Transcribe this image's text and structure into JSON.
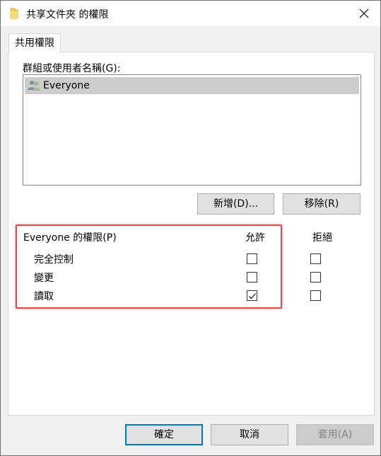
{
  "window": {
    "title": "共享文件夾 的權限",
    "close_label": "×"
  },
  "tabs": [
    {
      "label": "共用權限",
      "selected": true
    }
  ],
  "groups": {
    "label": "群組或使用者名稱(G):",
    "items": [
      {
        "name": "Everyone",
        "icon": "users-icon",
        "selected": true
      }
    ]
  },
  "group_buttons": {
    "add": "新增(D)...",
    "remove": "移除(R)"
  },
  "permissions": {
    "title": "Everyone 的權限(P)",
    "allow_header": "允許",
    "deny_header": "拒絕",
    "rows": [
      {
        "label": "完全控制",
        "allow": false,
        "deny": false
      },
      {
        "label": "變更",
        "allow": false,
        "deny": false
      },
      {
        "label": "讀取",
        "allow": true,
        "deny": false
      }
    ]
  },
  "footer": {
    "ok": "確定",
    "cancel": "取消",
    "apply": "套用(A)",
    "apply_enabled": false
  },
  "colors": {
    "highlight": "#e8474c",
    "selection": "#cccccc",
    "default_button_border": "#0078d7"
  }
}
